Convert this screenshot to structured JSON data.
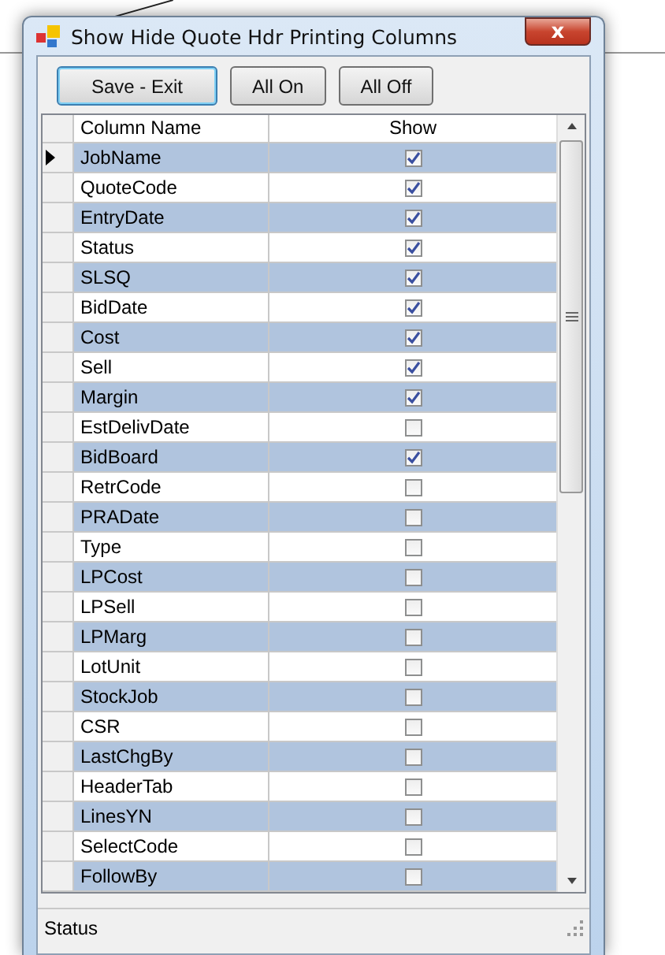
{
  "window": {
    "title": "Show Hide Quote Hdr Printing Columns",
    "close": "x"
  },
  "buttons": [
    {
      "label": "Save - Exit",
      "default": true
    },
    {
      "label": "All On",
      "default": false
    },
    {
      "label": "All Off",
      "default": false
    }
  ],
  "table": {
    "columns": [
      "Column Name",
      "Show"
    ],
    "rows": [
      {
        "name": "JobName",
        "checked": true,
        "selected": true
      },
      {
        "name": "QuoteCode",
        "checked": true,
        "selected": false
      },
      {
        "name": "EntryDate",
        "checked": true,
        "selected": false
      },
      {
        "name": "Status",
        "checked": true,
        "selected": false
      },
      {
        "name": "SLSQ",
        "checked": true,
        "selected": false
      },
      {
        "name": "BidDate",
        "checked": true,
        "selected": false
      },
      {
        "name": "Cost",
        "checked": true,
        "selected": false
      },
      {
        "name": "Sell",
        "checked": true,
        "selected": false
      },
      {
        "name": "Margin",
        "checked": true,
        "selected": false
      },
      {
        "name": "EstDelivDate",
        "checked": false,
        "selected": false
      },
      {
        "name": "BidBoard",
        "checked": true,
        "selected": false
      },
      {
        "name": "RetrCode",
        "checked": false,
        "selected": false
      },
      {
        "name": "PRADate",
        "checked": false,
        "selected": false
      },
      {
        "name": "Type",
        "checked": false,
        "selected": false
      },
      {
        "name": "LPCost",
        "checked": false,
        "selected": false
      },
      {
        "name": "LPSell",
        "checked": false,
        "selected": false
      },
      {
        "name": "LPMarg",
        "checked": false,
        "selected": false
      },
      {
        "name": "LotUnit",
        "checked": false,
        "selected": false
      },
      {
        "name": "StockJob",
        "checked": false,
        "selected": false
      },
      {
        "name": "CSR",
        "checked": false,
        "selected": false
      },
      {
        "name": "LastChgBy",
        "checked": false,
        "selected": false
      },
      {
        "name": "HeaderTab",
        "checked": false,
        "selected": false
      },
      {
        "name": "LinesYN",
        "checked": false,
        "selected": false
      },
      {
        "name": "SelectCode",
        "checked": false,
        "selected": false
      },
      {
        "name": "FollowBy",
        "checked": false,
        "selected": false
      }
    ]
  },
  "status_bar": "Status"
}
